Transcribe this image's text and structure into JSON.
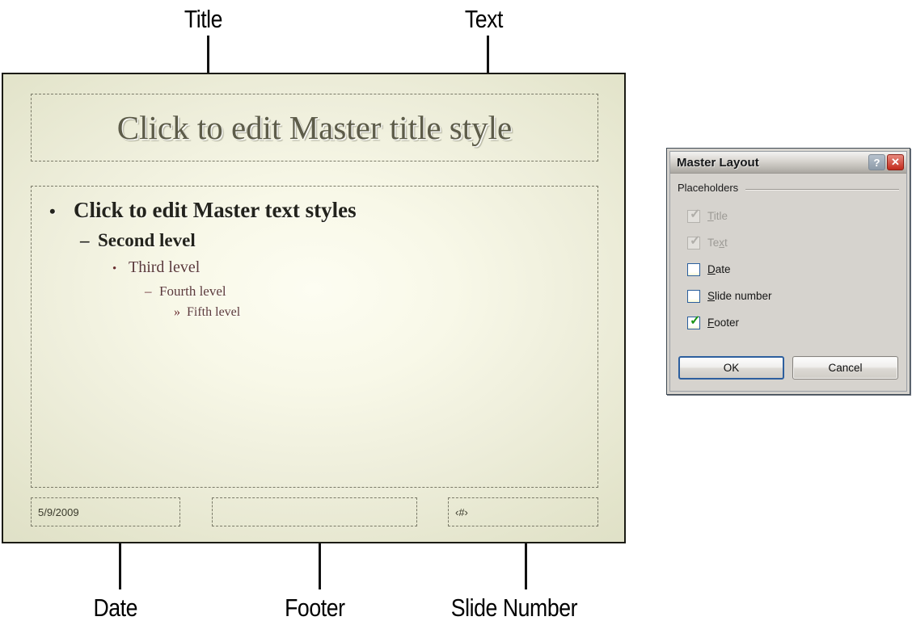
{
  "callouts": {
    "title": "Title",
    "text": "Text",
    "date": "Date",
    "footer": "Footer",
    "slide_number": "Slide Number"
  },
  "slide": {
    "title_placeholder": "Click to edit Master title style",
    "body_levels": [
      {
        "bullet": "•",
        "text": "Click to edit Master text styles"
      },
      {
        "bullet": "–",
        "text": "Second level"
      },
      {
        "bullet": "•",
        "text": "Third level"
      },
      {
        "bullet": "–",
        "text": "Fourth level"
      },
      {
        "bullet": "»",
        "text": "Fifth level"
      }
    ],
    "date_placeholder": "5/9/2009",
    "footer_placeholder": "",
    "number_placeholder": "‹#›"
  },
  "dialog": {
    "title": "Master Layout",
    "help_button": "?",
    "close_button": "✕",
    "group_label": "Placeholders",
    "checkboxes": [
      {
        "label_pre": "T",
        "label_accel": "T",
        "label": "Title",
        "checked": true,
        "enabled": false,
        "accel_index": 0
      },
      {
        "label": "Text",
        "checked": true,
        "enabled": false,
        "accel_index": 2
      },
      {
        "label": "Date",
        "checked": false,
        "enabled": true,
        "accel_index": 0
      },
      {
        "label": "Slide number",
        "checked": false,
        "enabled": true,
        "accel_index": 0
      },
      {
        "label": "Footer",
        "checked": true,
        "enabled": true,
        "accel_index": 0
      }
    ],
    "ok_label": "OK",
    "cancel_label": "Cancel"
  },
  "colors": {
    "slide_edge": "#dcddc3",
    "slide_center": "#fdfdf2",
    "accent_blue": "#2d5f9e",
    "check_green": "#1a9415",
    "close_red": "#c22a1c"
  }
}
